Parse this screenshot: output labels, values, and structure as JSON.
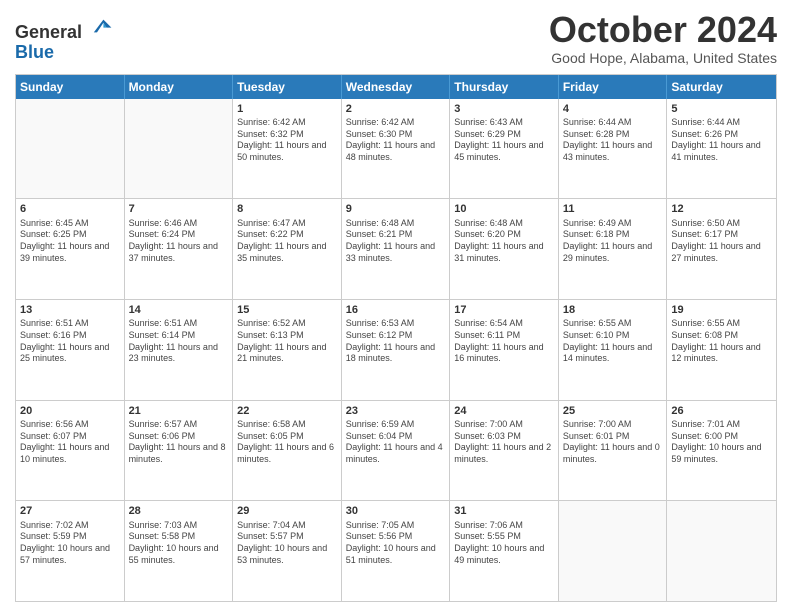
{
  "header": {
    "logo_line1": "General",
    "logo_line2": "Blue",
    "title": "October 2024",
    "subtitle": "Good Hope, Alabama, United States"
  },
  "days_of_week": [
    "Sunday",
    "Monday",
    "Tuesday",
    "Wednesday",
    "Thursday",
    "Friday",
    "Saturday"
  ],
  "weeks": [
    [
      {
        "day": "",
        "empty": true
      },
      {
        "day": "",
        "empty": true
      },
      {
        "day": "1",
        "sunrise": "Sunrise: 6:42 AM",
        "sunset": "Sunset: 6:32 PM",
        "daylight": "Daylight: 11 hours and 50 minutes."
      },
      {
        "day": "2",
        "sunrise": "Sunrise: 6:42 AM",
        "sunset": "Sunset: 6:30 PM",
        "daylight": "Daylight: 11 hours and 48 minutes."
      },
      {
        "day": "3",
        "sunrise": "Sunrise: 6:43 AM",
        "sunset": "Sunset: 6:29 PM",
        "daylight": "Daylight: 11 hours and 45 minutes."
      },
      {
        "day": "4",
        "sunrise": "Sunrise: 6:44 AM",
        "sunset": "Sunset: 6:28 PM",
        "daylight": "Daylight: 11 hours and 43 minutes."
      },
      {
        "day": "5",
        "sunrise": "Sunrise: 6:44 AM",
        "sunset": "Sunset: 6:26 PM",
        "daylight": "Daylight: 11 hours and 41 minutes."
      }
    ],
    [
      {
        "day": "6",
        "sunrise": "Sunrise: 6:45 AM",
        "sunset": "Sunset: 6:25 PM",
        "daylight": "Daylight: 11 hours and 39 minutes."
      },
      {
        "day": "7",
        "sunrise": "Sunrise: 6:46 AM",
        "sunset": "Sunset: 6:24 PM",
        "daylight": "Daylight: 11 hours and 37 minutes."
      },
      {
        "day": "8",
        "sunrise": "Sunrise: 6:47 AM",
        "sunset": "Sunset: 6:22 PM",
        "daylight": "Daylight: 11 hours and 35 minutes."
      },
      {
        "day": "9",
        "sunrise": "Sunrise: 6:48 AM",
        "sunset": "Sunset: 6:21 PM",
        "daylight": "Daylight: 11 hours and 33 minutes."
      },
      {
        "day": "10",
        "sunrise": "Sunrise: 6:48 AM",
        "sunset": "Sunset: 6:20 PM",
        "daylight": "Daylight: 11 hours and 31 minutes."
      },
      {
        "day": "11",
        "sunrise": "Sunrise: 6:49 AM",
        "sunset": "Sunset: 6:18 PM",
        "daylight": "Daylight: 11 hours and 29 minutes."
      },
      {
        "day": "12",
        "sunrise": "Sunrise: 6:50 AM",
        "sunset": "Sunset: 6:17 PM",
        "daylight": "Daylight: 11 hours and 27 minutes."
      }
    ],
    [
      {
        "day": "13",
        "sunrise": "Sunrise: 6:51 AM",
        "sunset": "Sunset: 6:16 PM",
        "daylight": "Daylight: 11 hours and 25 minutes."
      },
      {
        "day": "14",
        "sunrise": "Sunrise: 6:51 AM",
        "sunset": "Sunset: 6:14 PM",
        "daylight": "Daylight: 11 hours and 23 minutes."
      },
      {
        "day": "15",
        "sunrise": "Sunrise: 6:52 AM",
        "sunset": "Sunset: 6:13 PM",
        "daylight": "Daylight: 11 hours and 21 minutes."
      },
      {
        "day": "16",
        "sunrise": "Sunrise: 6:53 AM",
        "sunset": "Sunset: 6:12 PM",
        "daylight": "Daylight: 11 hours and 18 minutes."
      },
      {
        "day": "17",
        "sunrise": "Sunrise: 6:54 AM",
        "sunset": "Sunset: 6:11 PM",
        "daylight": "Daylight: 11 hours and 16 minutes."
      },
      {
        "day": "18",
        "sunrise": "Sunrise: 6:55 AM",
        "sunset": "Sunset: 6:10 PM",
        "daylight": "Daylight: 11 hours and 14 minutes."
      },
      {
        "day": "19",
        "sunrise": "Sunrise: 6:55 AM",
        "sunset": "Sunset: 6:08 PM",
        "daylight": "Daylight: 11 hours and 12 minutes."
      }
    ],
    [
      {
        "day": "20",
        "sunrise": "Sunrise: 6:56 AM",
        "sunset": "Sunset: 6:07 PM",
        "daylight": "Daylight: 11 hours and 10 minutes."
      },
      {
        "day": "21",
        "sunrise": "Sunrise: 6:57 AM",
        "sunset": "Sunset: 6:06 PM",
        "daylight": "Daylight: 11 hours and 8 minutes."
      },
      {
        "day": "22",
        "sunrise": "Sunrise: 6:58 AM",
        "sunset": "Sunset: 6:05 PM",
        "daylight": "Daylight: 11 hours and 6 minutes."
      },
      {
        "day": "23",
        "sunrise": "Sunrise: 6:59 AM",
        "sunset": "Sunset: 6:04 PM",
        "daylight": "Daylight: 11 hours and 4 minutes."
      },
      {
        "day": "24",
        "sunrise": "Sunrise: 7:00 AM",
        "sunset": "Sunset: 6:03 PM",
        "daylight": "Daylight: 11 hours and 2 minutes."
      },
      {
        "day": "25",
        "sunrise": "Sunrise: 7:00 AM",
        "sunset": "Sunset: 6:01 PM",
        "daylight": "Daylight: 11 hours and 0 minutes."
      },
      {
        "day": "26",
        "sunrise": "Sunrise: 7:01 AM",
        "sunset": "Sunset: 6:00 PM",
        "daylight": "Daylight: 10 hours and 59 minutes."
      }
    ],
    [
      {
        "day": "27",
        "sunrise": "Sunrise: 7:02 AM",
        "sunset": "Sunset: 5:59 PM",
        "daylight": "Daylight: 10 hours and 57 minutes."
      },
      {
        "day": "28",
        "sunrise": "Sunrise: 7:03 AM",
        "sunset": "Sunset: 5:58 PM",
        "daylight": "Daylight: 10 hours and 55 minutes."
      },
      {
        "day": "29",
        "sunrise": "Sunrise: 7:04 AM",
        "sunset": "Sunset: 5:57 PM",
        "daylight": "Daylight: 10 hours and 53 minutes."
      },
      {
        "day": "30",
        "sunrise": "Sunrise: 7:05 AM",
        "sunset": "Sunset: 5:56 PM",
        "daylight": "Daylight: 10 hours and 51 minutes."
      },
      {
        "day": "31",
        "sunrise": "Sunrise: 7:06 AM",
        "sunset": "Sunset: 5:55 PM",
        "daylight": "Daylight: 10 hours and 49 minutes."
      },
      {
        "day": "",
        "empty": true
      },
      {
        "day": "",
        "empty": true
      }
    ]
  ]
}
